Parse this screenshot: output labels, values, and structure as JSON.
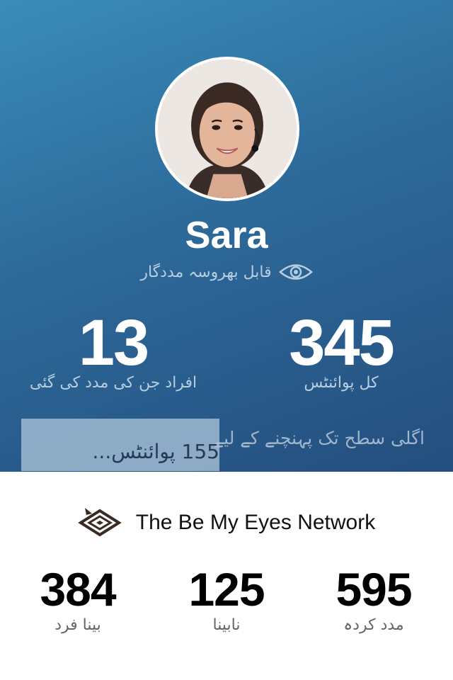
{
  "profile": {
    "name": "Sara",
    "avatar_icon": "person-with-headset",
    "badge_icon": "eye-icon",
    "badge_label": "قابل بھروسہ مددگار"
  },
  "stats": {
    "helped_count": "13",
    "helped_label": "افراد جن کی مدد کی گئی",
    "points_total": "345",
    "points_label": "کل پوائنٹس"
  },
  "progress": {
    "next_level_text": "اگلی سطح تک پہنچنے کے لیے",
    "next_level_overlay": "155 پوائنٹس..."
  },
  "network": {
    "title": "The Be My Eyes Network",
    "stats": [
      {
        "value": "384",
        "label": "بینا فرد"
      },
      {
        "value": "125",
        "label": "نابینا"
      },
      {
        "value": "595",
        "label": "مدد کردہ"
      }
    ]
  },
  "colors": {
    "hero_gradient_start": "#3a8cb8",
    "hero_gradient_end": "#244e7e",
    "muted_label": "#b7cde0"
  }
}
